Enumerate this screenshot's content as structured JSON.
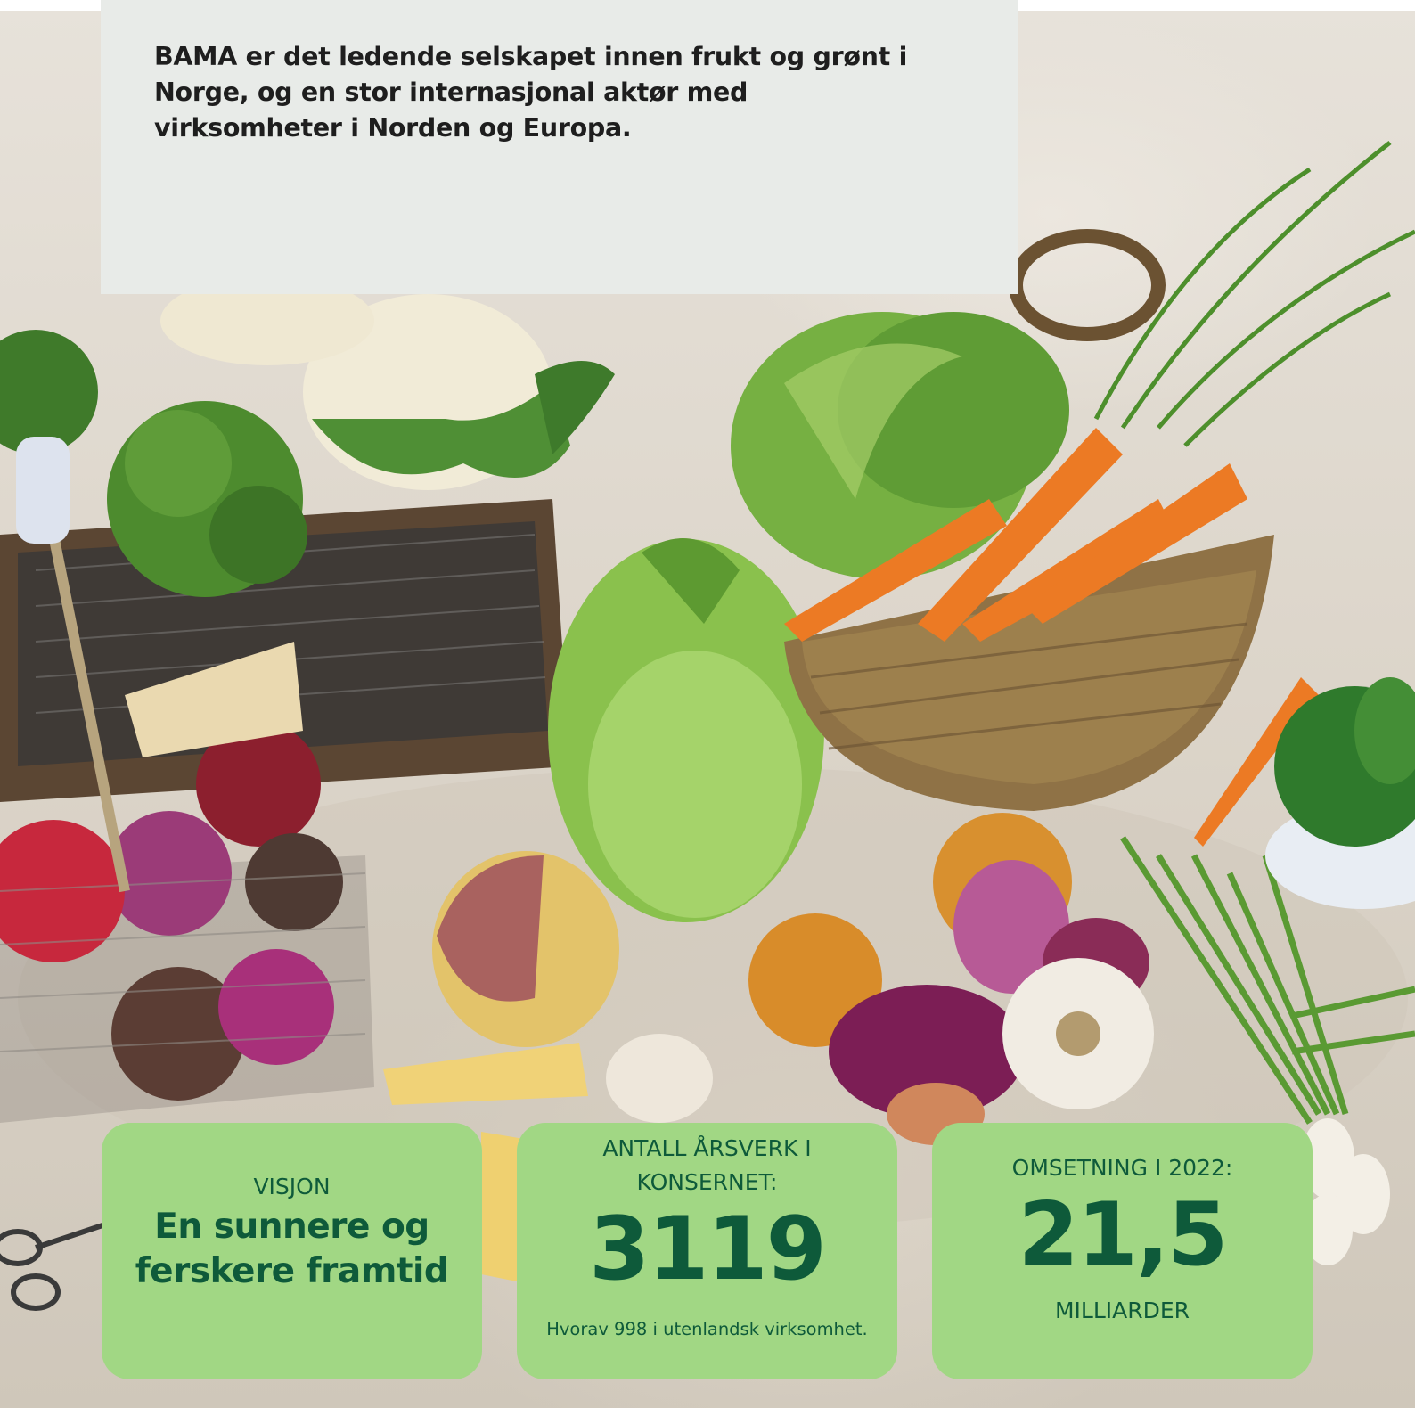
{
  "intro": {
    "text": "BAMA er det ledende selskapet innen frukt og grønt i Norge, og en stor internasjonal aktør med virksomheter i Norden og Europa."
  },
  "cards": [
    {
      "label": "VISJON",
      "headline": "En sunnere og ferskere framtid"
    },
    {
      "label": "ANTALL ÅRSVERK I KONSERNET:",
      "value": "3119",
      "note": "Hvorav 998 i utenlandsk virksomhet."
    },
    {
      "label": "OMSETNING I 2022:",
      "value": "21,5",
      "unit": "MILLIARDER"
    }
  ],
  "colors": {
    "card_bg": "#a1d784",
    "card_text": "#0e5a3a",
    "intro_bg": "#e8ebe8",
    "intro_text": "#1e1e1e"
  }
}
